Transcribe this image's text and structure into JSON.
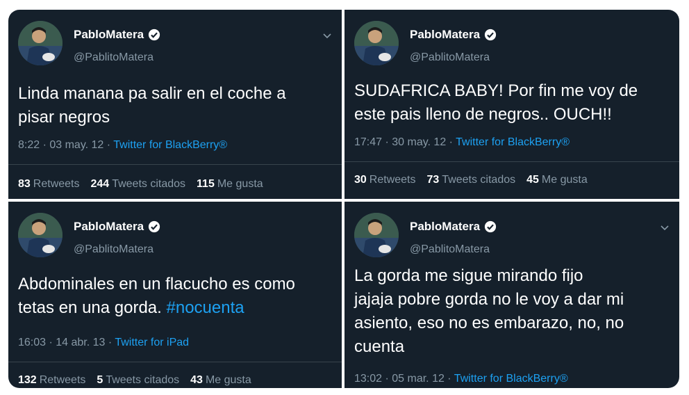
{
  "tweets": [
    {
      "name": "PabloMatera",
      "handle": "@PablitoMatera",
      "text": "Linda manana pa salir en el coche a\npisar negros",
      "hashtag": "",
      "time": "8:22 · 03 may. 12 · ",
      "client": "Twitter for BlackBerry®",
      "retweets": "83",
      "retweets_label": "Retweets",
      "quotes": "244",
      "quotes_label": "Tweets citados",
      "likes": "115",
      "likes_label": "Me gusta"
    },
    {
      "name": "PabloMatera",
      "handle": "@PablitoMatera",
      "text": "SUDAFRICA BABY! Por fin me voy de\neste pais lleno de negros..   OUCH!!",
      "hashtag": "",
      "time": "17:47 · 30 may. 12 · ",
      "client": "Twitter for BlackBerry®",
      "retweets": "30",
      "retweets_label": "Retweets",
      "quotes": "73",
      "quotes_label": "Tweets citados",
      "likes": "45",
      "likes_label": "Me gusta"
    },
    {
      "name": "PabloMatera",
      "handle": "@PablitoMatera",
      "text": "Abdominales en un flacucho es como\ntetas en una gorda. ",
      "hashtag": "#nocuenta",
      "time": "16:03 · 14 abr. 13 · ",
      "client": "Twitter for iPad",
      "retweets": "132",
      "retweets_label": "Retweets",
      "quotes": "5",
      "quotes_label": "Tweets citados",
      "likes": "43",
      "likes_label": "Me gusta"
    },
    {
      "name": "PabloMatera",
      "handle": "@PablitoMatera",
      "text": "La gorda me sigue mirando fijo\njajaja pobre gorda no le voy a dar mi\nasiento, eso no es embarazo, no, no\ncuenta",
      "hashtag": "",
      "time": "13:02 · 05 mar. 12 · ",
      "client": "Twitter for BlackBerry®"
    }
  ],
  "colors": {
    "background": "#15202b",
    "secondary_text": "#8899a6",
    "link": "#1da1f2",
    "verified": "#ffffff"
  },
  "icons": {
    "verified": "verified-badge-icon",
    "menu": "chevron-down-icon"
  }
}
